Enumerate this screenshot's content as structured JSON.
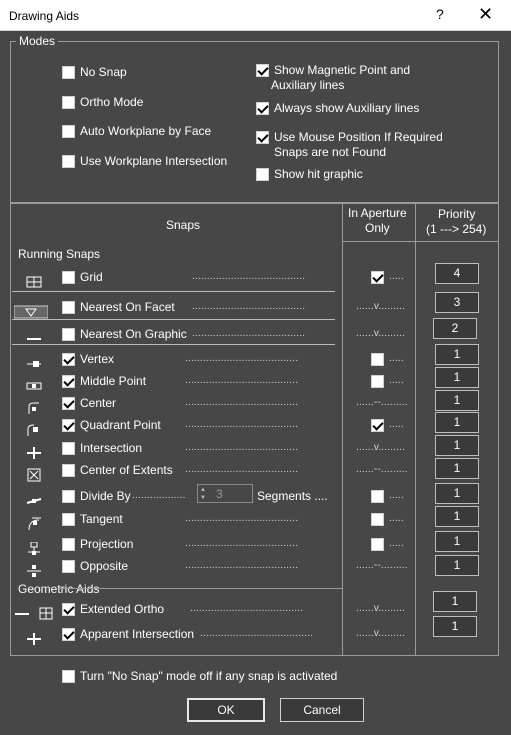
{
  "window": {
    "title": "Drawing Aids",
    "help": "?",
    "close": "✕"
  },
  "modes": {
    "legend": "Modes",
    "left": [
      {
        "label": "No Snap",
        "checked": false
      },
      {
        "label": "Ortho Mode",
        "checked": false
      },
      {
        "label": "Auto Workplane by Face",
        "checked": false
      },
      {
        "label": "Use Workplane Intersection",
        "checked": false
      }
    ],
    "right": [
      {
        "line1": "Show Magnetic Point and",
        "line2": "Auxiliary lines",
        "checked": true
      },
      {
        "line1": "Always show Auxiliary lines",
        "line2": "",
        "checked": true
      },
      {
        "line1": "Use Mouse Position If Required",
        "line2": "Snaps are not  Found",
        "checked": true
      },
      {
        "line1": "Show hit graphic",
        "line2": "",
        "checked": false
      }
    ]
  },
  "columns": {
    "snaps": "Snaps",
    "aperture_line1": "In Aperture",
    "aperture_line2": "Only",
    "priority_line1": "Priority",
    "priority_line2": "(1 ---> 254)"
  },
  "running_snaps_label": "Running Snaps",
  "geometric_aids_label": "Geometric Aids",
  "snaps": [
    {
      "id": "grid",
      "label": "Grid",
      "icon": "grid-icon",
      "checked": false,
      "dots": "......................................",
      "aperture": "cb-on",
      "ap_text": ".....",
      "priority": "4"
    },
    {
      "id": "nearest-facet",
      "label": "Nearest On Facet",
      "icon": "nearest-facet-icon",
      "checked": false,
      "dots": "......................................",
      "aperture": "v",
      "ap_text": "......v.........",
      "priority": "3"
    },
    {
      "id": "nearest-graphic",
      "label": "Nearest On Graphic",
      "icon": "nearest-graphic-icon",
      "checked": false,
      "dots": "......................................",
      "aperture": "v",
      "ap_text": "......v.........",
      "priority": "2"
    },
    {
      "id": "vertex",
      "label": "Vertex",
      "icon": "vertex-icon",
      "checked": true,
      "dots": "......................................",
      "aperture": "cb-off",
      "ap_text": ".....",
      "priority": "1"
    },
    {
      "id": "middle-point",
      "label": "Middle Point",
      "icon": "middle-point-icon",
      "checked": true,
      "dots": "......................................",
      "aperture": "cb-off",
      "ap_text": ".....",
      "priority": "1"
    },
    {
      "id": "center",
      "label": "Center",
      "icon": "center-icon",
      "checked": true,
      "dots": "......................................",
      "aperture": "dash",
      "ap_text": "......--.........",
      "priority": "1"
    },
    {
      "id": "quadrant-point",
      "label": "Quadrant Point",
      "icon": "quadrant-point-icon",
      "checked": true,
      "dots": "......................................",
      "aperture": "cb-on",
      "ap_text": ".....",
      "priority": "1"
    },
    {
      "id": "intersection",
      "label": "Intersection",
      "icon": "intersection-icon",
      "checked": false,
      "dots": "......................................",
      "aperture": "v",
      "ap_text": "......v.........",
      "priority": "1"
    },
    {
      "id": "center-extents",
      "label": "Center of Extents",
      "icon": "center-extents-icon",
      "checked": false,
      "dots": "......................................",
      "aperture": "dash",
      "ap_text": "......--.........",
      "priority": "1"
    },
    {
      "id": "divide-by",
      "label": "Divide By",
      "icon": "divide-by-icon",
      "checked": false,
      "dots": "..................",
      "aperture": "cb-off",
      "ap_text": ".....",
      "priority": "1",
      "stepper": "3",
      "segments": "Segments ...."
    },
    {
      "id": "tangent",
      "label": "Tangent",
      "icon": "tangent-icon",
      "checked": false,
      "dots": "......................................",
      "aperture": "cb-off",
      "ap_text": ".....",
      "priority": "1"
    },
    {
      "id": "projection",
      "label": "Projection",
      "icon": "projection-icon",
      "checked": false,
      "dots": "......................................",
      "aperture": "cb-off",
      "ap_text": ".....",
      "priority": "1"
    },
    {
      "id": "opposite",
      "label": "Opposite",
      "icon": "opposite-icon",
      "checked": false,
      "dots": "......................................",
      "aperture": "dash",
      "ap_text": "......--.........",
      "priority": "1"
    }
  ],
  "aids": [
    {
      "id": "extended-ortho",
      "label": "Extended Ortho",
      "checked": true,
      "dots": "......................................",
      "ap_text": "......v.........",
      "priority": "1"
    },
    {
      "id": "apparent-intersection",
      "label": "Apparent Intersection",
      "checked": true,
      "dots": "......................................",
      "ap_text": "......v.........",
      "priority": "1"
    }
  ],
  "footer": {
    "no_snap_off": "Turn \"No Snap\" mode off if any snap is activated",
    "ok": "OK",
    "cancel": "Cancel"
  }
}
